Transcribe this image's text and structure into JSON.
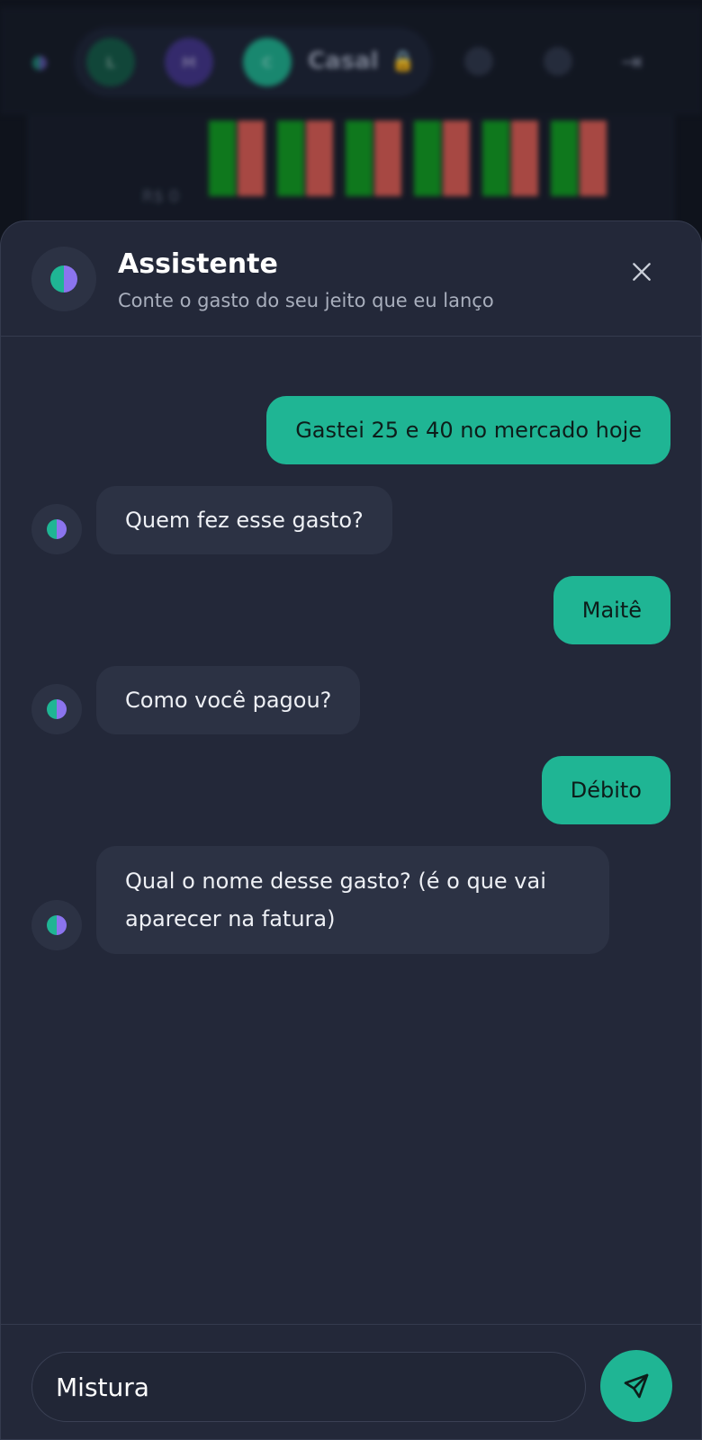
{
  "background": {
    "avatars": [
      "L",
      "M",
      "C"
    ],
    "group_label": "Casal",
    "chart_axis_label": "R$ 0"
  },
  "assistant": {
    "title": "Assistente",
    "subtitle": "Conte o gasto do seu jeito que eu lanço"
  },
  "messages": [
    {
      "role": "user",
      "text": "Gastei 25 e 40 no mercado hoje"
    },
    {
      "role": "assistant",
      "text": "Quem fez esse gasto?"
    },
    {
      "role": "user",
      "text": "Maitê"
    },
    {
      "role": "assistant",
      "text": "Como você pagou?"
    },
    {
      "role": "user",
      "text": "Débito"
    },
    {
      "role": "assistant",
      "text": "Qual o nome desse gasto? (é o que vai aparecer na fatura)"
    }
  ],
  "composer": {
    "value": "Mistura"
  },
  "colors": {
    "accent": "#1fb594",
    "secondary": "#8b74ee",
    "sheet_bg": "#232839",
    "bubble_bot": "#2c3244"
  },
  "icons": {
    "close": "close-icon",
    "send": "send-icon",
    "assistant": "assistant-logo-icon"
  }
}
